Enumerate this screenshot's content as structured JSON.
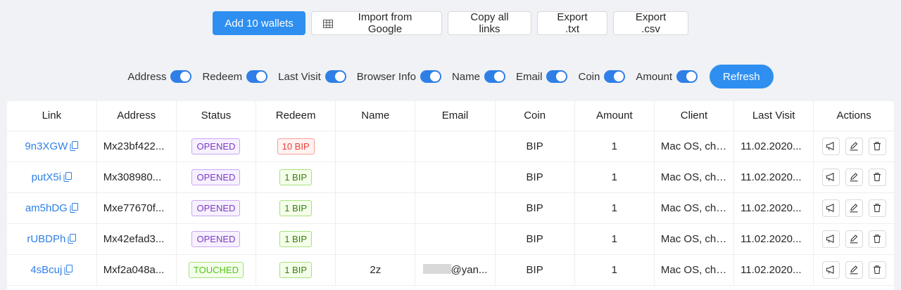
{
  "toolbar": {
    "add_label": "Add 10 wallets",
    "import_label": "Import from Google",
    "copy_label": "Copy all links",
    "export_txt_label": "Export .txt",
    "export_csv_label": "Export .csv"
  },
  "toggles": [
    {
      "label": "Address",
      "on": true
    },
    {
      "label": "Redeem",
      "on": true
    },
    {
      "label": "Last Visit",
      "on": true
    },
    {
      "label": "Browser Info",
      "on": true
    },
    {
      "label": "Name",
      "on": true
    },
    {
      "label": "Email",
      "on": true
    },
    {
      "label": "Coin",
      "on": true
    },
    {
      "label": "Amount",
      "on": true
    }
  ],
  "refresh_label": "Refresh",
  "table": {
    "columns": [
      "Link",
      "Address",
      "Status",
      "Redeem",
      "Name",
      "Email",
      "Coin",
      "Amount",
      "Client",
      "Last Visit",
      "Actions"
    ],
    "rows": [
      {
        "link": "9n3XGW",
        "address": "Mx23bf422...",
        "status": "OPENED",
        "redeem": "10 BIP",
        "name": "",
        "email": "",
        "coin": "BIP",
        "amount": "1",
        "client": "Mac OS, chr...",
        "last_visit": "11.02.2020..."
      },
      {
        "link": "putX5i",
        "address": "Mx308980...",
        "status": "OPENED",
        "redeem": "1 BIP",
        "name": "",
        "email": "",
        "coin": "BIP",
        "amount": "1",
        "client": "Mac OS, chr...",
        "last_visit": "11.02.2020..."
      },
      {
        "link": "am5hDG",
        "address": "Mxe77670f...",
        "status": "OPENED",
        "redeem": "1 BIP",
        "name": "",
        "email": "",
        "coin": "BIP",
        "amount": "1",
        "client": "Mac OS, chr...",
        "last_visit": "11.02.2020..."
      },
      {
        "link": "rUBDPh",
        "address": "Mx42efad3...",
        "status": "OPENED",
        "redeem": "1 BIP",
        "name": "",
        "email": "",
        "coin": "BIP",
        "amount": "1",
        "client": "Mac OS, chr...",
        "last_visit": "11.02.2020..."
      },
      {
        "link": "4sBcuj",
        "address": "Mxf2a048a...",
        "status": "TOUCHED",
        "redeem": "1 BIP",
        "name": "2z",
        "email": "@yan...",
        "coin": "BIP",
        "amount": "1",
        "client": "Mac OS, chr...",
        "last_visit": "11.02.2020..."
      }
    ]
  },
  "icons": {
    "copy": "copy-icon",
    "action_1": "megaphone-icon",
    "action_2": "edit-icon",
    "action_3": "trash-icon",
    "import": "table-icon"
  },
  "colors": {
    "primary": "#2f8ff0",
    "link": "#2f7fe6",
    "opened": "#7b3cc4",
    "touched": "#52c41a",
    "bip10": "#e5403a"
  }
}
